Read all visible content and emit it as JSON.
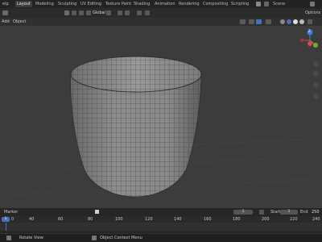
{
  "menubar": {
    "app_menu": "elp",
    "tabs": [
      "Layout",
      "Modeling",
      "Sculpting",
      "UV Editing",
      "Texture Paint",
      "Shading",
      "Animation",
      "Rendering",
      "Compositing",
      "Scripting"
    ],
    "scene_label": "Scene"
  },
  "header": {
    "transform_orientation": "Global",
    "options_label": "Options"
  },
  "subheader": {
    "add_label": "Add",
    "object_label": "Object"
  },
  "gizmo": {
    "z_label": "Z",
    "y_label": "Y",
    "x_label": "X"
  },
  "timeline": {
    "marker_label": "Marker",
    "current_frame": "1",
    "start_label": "Start",
    "start_value": "1",
    "end_label": "End",
    "end_value": "250",
    "ruler_ticks": [
      "0",
      "40",
      "60",
      "80",
      "100",
      "120",
      "140",
      "160",
      "180",
      "200",
      "220",
      "240"
    ]
  },
  "statusbar": {
    "rotate_label": "Rotate View",
    "context_label": "Object Context Menu"
  },
  "colors": {
    "accent": "#e69640",
    "axis_x": "#e04455",
    "axis_y": "#6fb02f",
    "axis_z": "#3d7fe0"
  }
}
